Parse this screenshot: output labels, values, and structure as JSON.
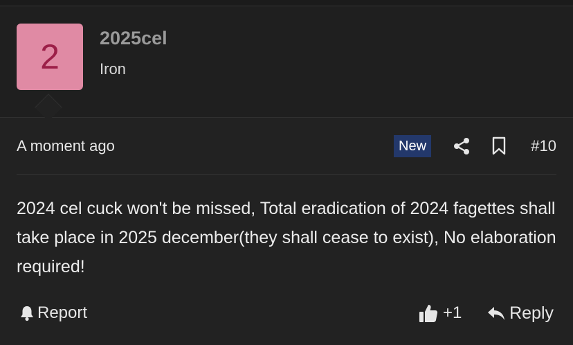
{
  "user": {
    "avatar_letter": "2",
    "avatar_color": "#e08aa4",
    "username": "2025cel",
    "rank": "Iron"
  },
  "post": {
    "timestamp": "A moment ago",
    "badge": "New",
    "badge_color": "#23386b",
    "number": "#10",
    "body": "2024 cel cuck won't be missed, Total eradication of 2024 fagettes shall take place in 2025 december(they shall cease to exist), No elaboration required!"
  },
  "actions": {
    "report_label": "Report",
    "like_count": "+1",
    "reply_label": "Reply"
  },
  "icons": [
    "share-icon",
    "bookmark-icon",
    "bell-icon",
    "thumbs-up-icon",
    "reply-arrow-icon"
  ]
}
